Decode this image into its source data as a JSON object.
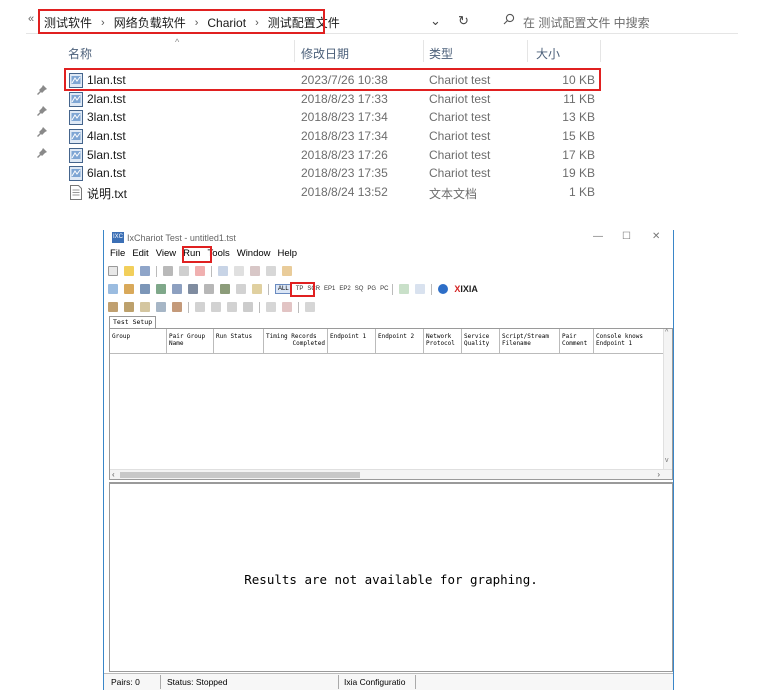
{
  "explorer": {
    "breadcrumbs": [
      "测试软件",
      "网络负载软件",
      "Chariot",
      "测试配置文件"
    ],
    "search_placeholder": "在 测试配置文件 中搜索",
    "columns": {
      "name": "名称",
      "modified": "修改日期",
      "type": "类型",
      "size": "大小"
    },
    "files": [
      {
        "name": "1lan.tst",
        "modified": "2023/7/26 10:38",
        "type": "Chariot test",
        "size": "10 KB",
        "icon": "chariot-file-icon"
      },
      {
        "name": "2lan.tst",
        "modified": "2018/8/23 17:33",
        "type": "Chariot test",
        "size": "11 KB",
        "icon": "chariot-file-icon"
      },
      {
        "name": "3lan.tst",
        "modified": "2018/8/23 17:34",
        "type": "Chariot test",
        "size": "13 KB",
        "icon": "chariot-file-icon"
      },
      {
        "name": "4lan.tst",
        "modified": "2018/8/23 17:34",
        "type": "Chariot test",
        "size": "15 KB",
        "icon": "chariot-file-icon"
      },
      {
        "name": "5lan.tst",
        "modified": "2018/8/23 17:26",
        "type": "Chariot test",
        "size": "17 KB",
        "icon": "chariot-file-icon"
      },
      {
        "name": "6lan.tst",
        "modified": "2018/8/23 17:35",
        "type": "Chariot test",
        "size": "19 KB",
        "icon": "chariot-file-icon"
      },
      {
        "name": "说明.txt",
        "modified": "2018/8/24 13:52",
        "type": "文本文档",
        "size": "1 KB",
        "icon": "text-file-icon"
      }
    ]
  },
  "ixchariot": {
    "title": "IxChariot Test - untitled1.tst",
    "menu": [
      "File",
      "Edit",
      "View",
      "Run",
      "Tools",
      "Window",
      "Help"
    ],
    "toolbar_text": [
      "ALL",
      "TP",
      "SCR",
      "EP1",
      "EP2",
      "SQ",
      "PG",
      "PC"
    ],
    "logo": "XIXIA",
    "tab": "Test Setup",
    "grid_columns": [
      {
        "l1": "",
        "l2": "Group"
      },
      {
        "l1": "Pair Group",
        "l2": "Name"
      },
      {
        "l1": "",
        "l2": "Run Status"
      },
      {
        "l1": "Timing Records",
        "l2": "Completed"
      },
      {
        "l1": "",
        "l2": "Endpoint 1"
      },
      {
        "l1": "",
        "l2": "Endpoint 2"
      },
      {
        "l1": "Network",
        "l2": "Protocol"
      },
      {
        "l1": "Service",
        "l2": "Quality"
      },
      {
        "l1": "Script/Stream",
        "l2": "Filename"
      },
      {
        "l1": "Pair",
        "l2": "Comment"
      },
      {
        "l1": "Console knows",
        "l2": "Endpoint 1"
      }
    ],
    "chart_message": "Results are not available for graphing.",
    "status": {
      "pairs": "Pairs: 0",
      "state": "Status: Stopped",
      "config": "Ixia Configuratio"
    }
  },
  "colors": {
    "highlight": "#e02020",
    "window_border": "#3a86c8"
  }
}
